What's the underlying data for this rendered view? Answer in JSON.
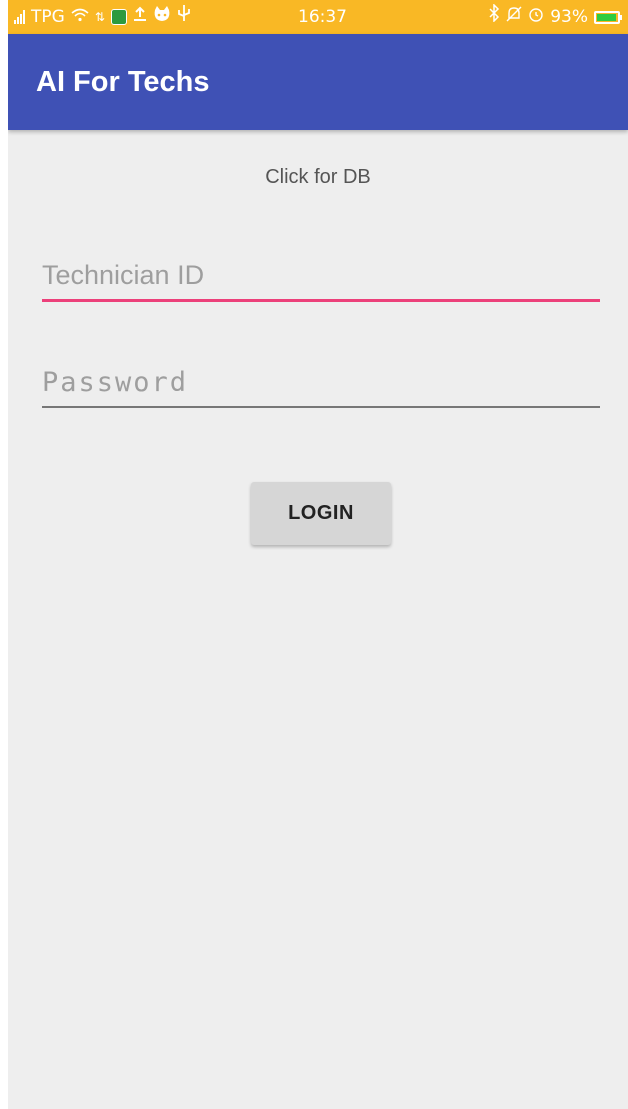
{
  "status_bar": {
    "carrier": "TPG",
    "time": "16:37",
    "battery_percent": "93%",
    "icons": [
      "signal-icon",
      "wifi-icon",
      "data-icon",
      "app-icon",
      "upload-icon",
      "cat-icon",
      "usb-icon",
      "bluetooth-icon",
      "mute-icon",
      "alarm-icon",
      "battery-icon"
    ]
  },
  "app_bar": {
    "title": "AI For Techs",
    "color": "#3f51b5"
  },
  "main": {
    "db_link": "Click for DB",
    "technician_id": {
      "value": "",
      "placeholder": "Technician ID"
    },
    "password": {
      "value": "",
      "placeholder": "Password"
    },
    "login_label": "LOGIN"
  },
  "colors": {
    "status_bar": "#f9b825",
    "accent": "#ec407a",
    "background": "#eeeeee"
  }
}
